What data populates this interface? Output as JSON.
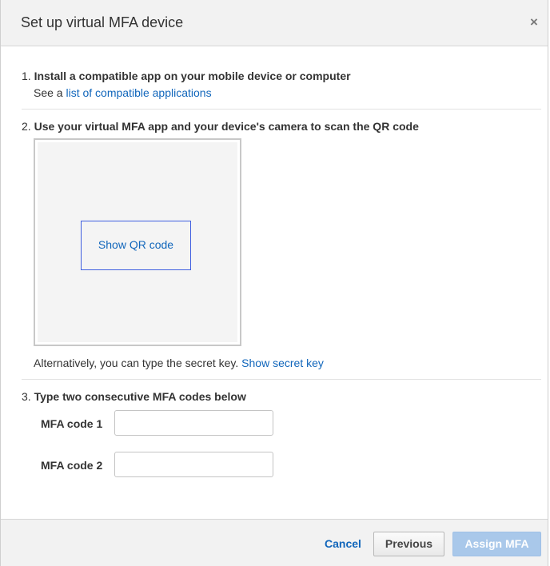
{
  "dialog": {
    "title": "Set up virtual MFA device",
    "close_glyph": "×"
  },
  "step1": {
    "number": "1.",
    "title": "Install a compatible app on your mobile device or computer",
    "see_prefix": "See a",
    "link_text": "list of compatible applications"
  },
  "step2": {
    "number": "2.",
    "title": "Use your virtual MFA app and your device's camera to scan the QR code",
    "qr_button_label": "Show QR code",
    "alt_text": "Alternatively, you can type the secret key.",
    "secret_link_text": "Show secret key"
  },
  "step3": {
    "number": "3.",
    "title": "Type two consecutive MFA codes below",
    "fields": [
      {
        "label": "MFA code 1",
        "value": "",
        "placeholder": ""
      },
      {
        "label": "MFA code 2",
        "value": "",
        "placeholder": ""
      }
    ]
  },
  "footer": {
    "cancel_label": "Cancel",
    "previous_label": "Previous",
    "assign_label": "Assign MFA"
  },
  "colors": {
    "link": "#1166bb",
    "primary_disabled": "#a9c8ea",
    "header_bg": "#f2f2f2"
  },
  "icons": {
    "close": "close-icon"
  }
}
